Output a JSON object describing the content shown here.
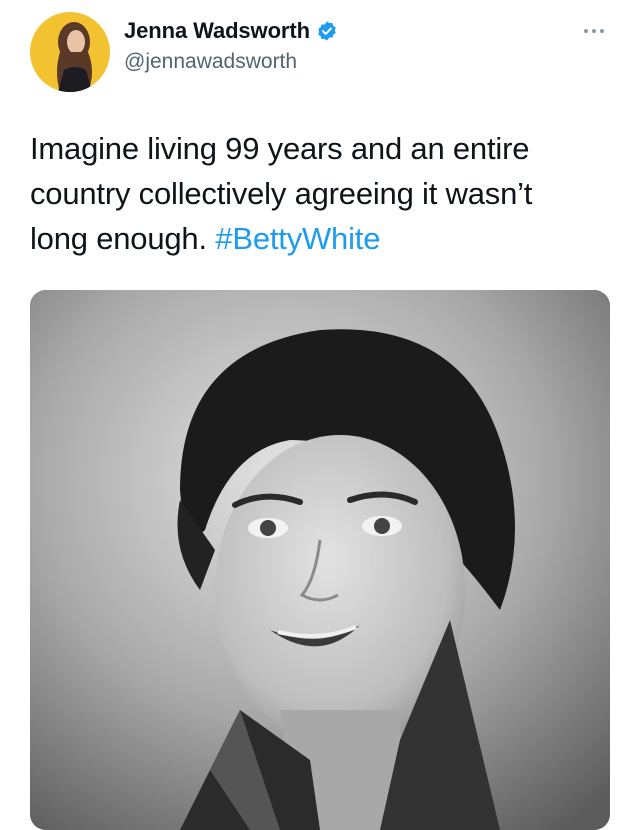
{
  "author": {
    "display_name": "Jenna Wadsworth",
    "handle": "@jennawadsworth",
    "verified": true
  },
  "tweet": {
    "text_lines": [
      "Imagine living 99 years and an entire",
      "country collectively agreeing it wasn’t",
      "long enough."
    ],
    "hashtag": "#BettyWhite"
  },
  "icons": {
    "verified": "verified-badge-icon",
    "more": "more-options-icon"
  },
  "colors": {
    "hashtag": "#1d9bf0",
    "verified_badge": "#1d9bf0",
    "avatar_background": "#f2c230"
  }
}
